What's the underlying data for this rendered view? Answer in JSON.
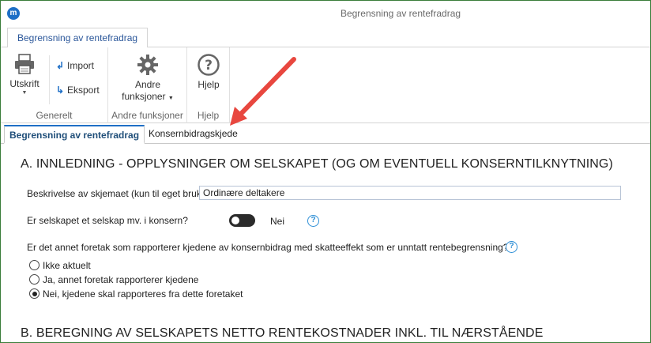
{
  "window": {
    "title": "Begrensning av rentefradrag",
    "app_icon": "m"
  },
  "ribbon": {
    "tab_label": "Begrensning av rentefradrag",
    "groups": {
      "generelt": {
        "label": "Generelt",
        "print_label": "Utskrift",
        "import_label": "Import",
        "export_label": "Eksport"
      },
      "andre": {
        "label": "Andre funksjoner",
        "button_line1": "Andre",
        "button_line2": "funksjoner"
      },
      "hjelp": {
        "label": "Hjelp",
        "button_label": "Hjelp"
      }
    }
  },
  "doc_tabs": {
    "active": "Begrensning av rentefradrag",
    "inactive": "Konsernbidragskjede"
  },
  "form": {
    "section_a_title": "A. INNLEDNING - OPPLYSNINGER OM SELSKAPET (OG OM EVENTUELL KONSERNTILKNYTNING)",
    "description_label": "Beskrivelse av skjemaet (kun til eget bruk)",
    "description_value": "Ordinære deltakere",
    "konsern_label": "Er selskapet et selskap mv. i konsern?",
    "konsern_toggle_text": "Nei",
    "konsern_toggle_on": false,
    "other_company_question": "Er det annet foretak som rapporterer kjedene av konsernbidrag med skatteeffekt som er unntatt rentebegrensning?",
    "options": [
      {
        "label": "Ikke aktuelt",
        "checked": false
      },
      {
        "label": "Ja, annet foretak rapporterer kjedene",
        "checked": false
      },
      {
        "label": "Nei, kjedene skal rapporteres fra dette foretaket",
        "checked": true
      }
    ],
    "section_b_title": "B. BEREGNING AV SELSKAPETS NETTO RENTEKOSTNADER INKL. TIL NÆRSTÅENDE",
    "help_glyph": "?"
  },
  "colors": {
    "accent": "#1e6fc6",
    "help": "#2e8fd6",
    "arrow": "#e8473f"
  }
}
